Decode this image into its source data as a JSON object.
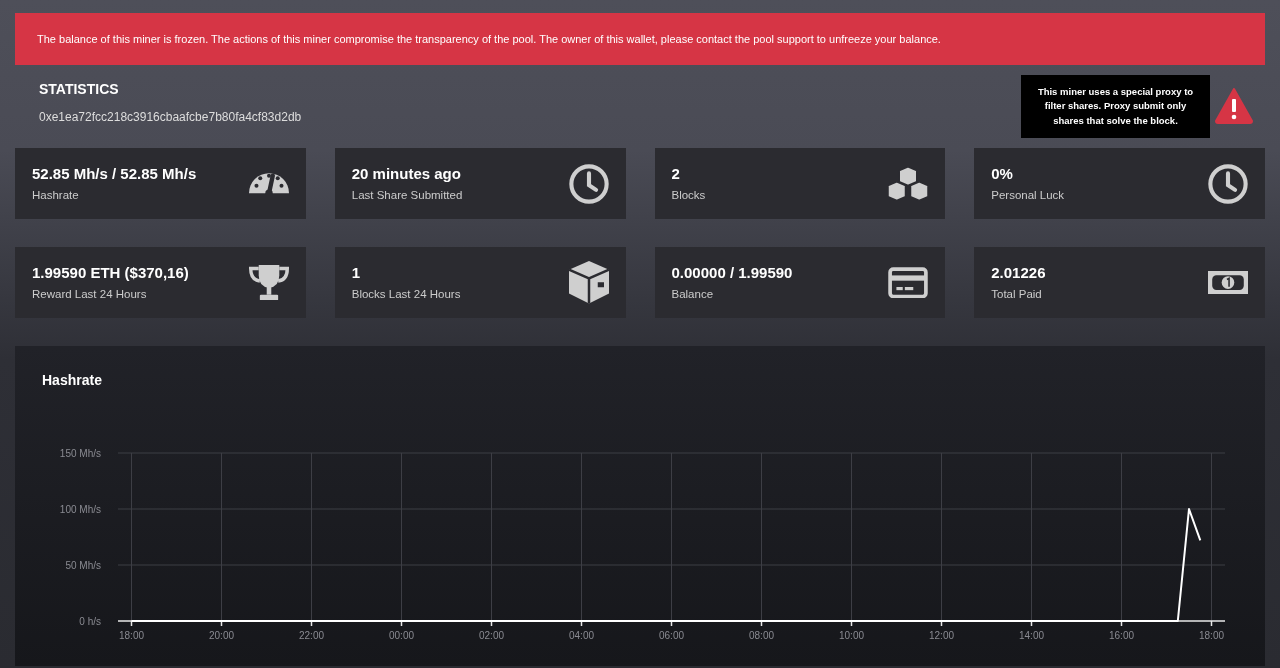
{
  "alert": {
    "text": "The balance of this miner is frozen. The actions of this miner compromise the transparency of the pool. The owner of this wallet, please contact the pool support to unfreeze your balance."
  },
  "header": {
    "title": "STATISTICS",
    "address": "0xe1ea72fcc218c3916cbaafcbe7b80fa4cf83d2db"
  },
  "warning": {
    "tooltip": "This miner uses a special proxy to filter shares. Proxy submit only shares that solve the block."
  },
  "stats": [
    {
      "value": "52.85 Mh/s / 52.85 Mh/s",
      "label": "Hashrate"
    },
    {
      "value": "20 minutes ago",
      "label": "Last Share Submitted"
    },
    {
      "value": "2",
      "label": "Blocks"
    },
    {
      "value": "0%",
      "label": "Personal Luck"
    },
    {
      "value": "1.99590 ETH ($370,16)",
      "label": "Reward Last 24 Hours"
    },
    {
      "value": "1",
      "label": "Blocks Last 24 Hours"
    },
    {
      "value": "0.00000 / 1.99590",
      "label": "Balance"
    },
    {
      "value": "2.01226",
      "label": "Total Paid"
    }
  ],
  "hashrate_chart": {
    "title": "Hashrate",
    "chart_data": {
      "type": "line",
      "categories": [
        "18:00",
        null,
        null,
        null,
        null,
        null,
        null,
        null,
        "20:00",
        null,
        null,
        null,
        null,
        null,
        null,
        null,
        "22:00",
        null,
        null,
        null,
        null,
        null,
        null,
        null,
        "00:00",
        null,
        null,
        null,
        null,
        null,
        null,
        null,
        "02:00",
        null,
        null,
        null,
        null,
        null,
        null,
        null,
        "04:00",
        null,
        null,
        null,
        null,
        null,
        null,
        null,
        "06:00",
        null,
        null,
        null,
        null,
        null,
        null,
        null,
        "08:00",
        null,
        null,
        null,
        null,
        null,
        null,
        null,
        "10:00",
        null,
        null,
        null,
        null,
        null,
        null,
        null,
        "12:00",
        null,
        null,
        null,
        null,
        null,
        null,
        null,
        "14:00",
        null,
        null,
        null,
        null,
        null,
        null,
        null,
        "16:00",
        null,
        null,
        null,
        null,
        null,
        null,
        null,
        "18:00"
      ],
      "series": [
        {
          "color": "#ffffff",
          "values": [
            0,
            0,
            0,
            0,
            0,
            0,
            0,
            0,
            0,
            0,
            0,
            0,
            0,
            0,
            0,
            0,
            0,
            0,
            0,
            0,
            0,
            0,
            0,
            0,
            0,
            0,
            0,
            0,
            0,
            0,
            0,
            0,
            0,
            0,
            0,
            0,
            0,
            0,
            0,
            0,
            0,
            0,
            0,
            0,
            0,
            0,
            0,
            0,
            0,
            0,
            0,
            0,
            0,
            0,
            0,
            0,
            0,
            0,
            0,
            0,
            0,
            0,
            0,
            0,
            0,
            0,
            0,
            0,
            0,
            0,
            0,
            0,
            0,
            0,
            0,
            0,
            0,
            0,
            0,
            0,
            0,
            0,
            0,
            0,
            0,
            0,
            0,
            0,
            0,
            0,
            0,
            0,
            0,
            0,
            100,
            72,
            null
          ]
        }
      ],
      "ylim": [
        0,
        150
      ],
      "grid": true,
      "yticks": [
        {
          "value": 0,
          "label": "0 h/s"
        },
        {
          "value": 50,
          "label": "50 Mh/s"
        },
        {
          "value": 100,
          "label": "100 Mh/s"
        },
        {
          "value": 150,
          "label": "150 Mh/s"
        }
      ]
    }
  }
}
